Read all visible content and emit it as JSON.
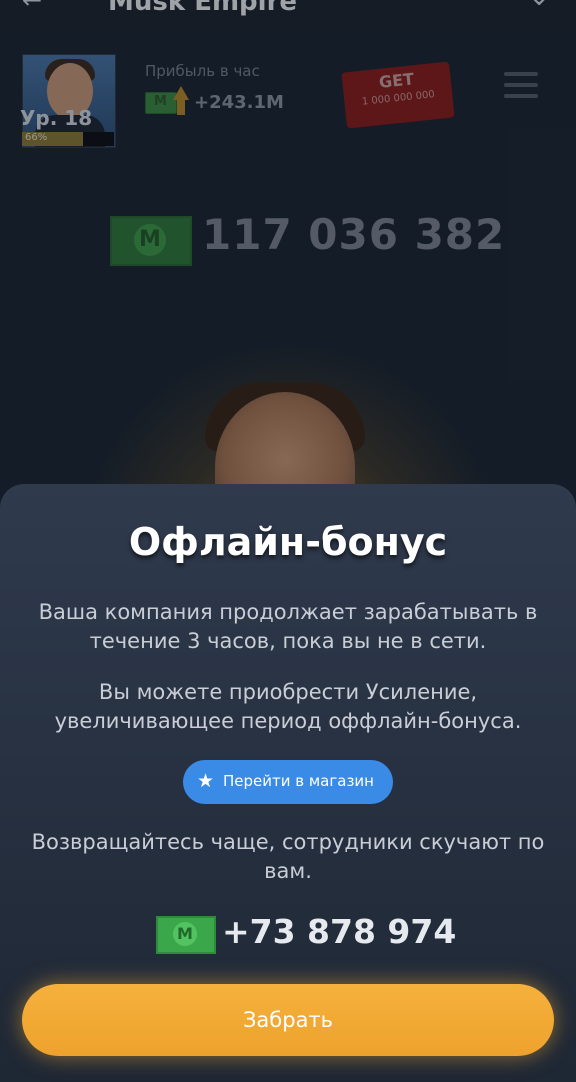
{
  "topbar": {
    "back": "←",
    "title": "Musk Empire",
    "chevron": "⌄"
  },
  "player": {
    "level_label": "Ур. 18",
    "progress_text": "66%",
    "progress": 0.66
  },
  "profit": {
    "label": "Прибыль в час",
    "value": "+243.1M"
  },
  "ticket": {
    "title": "GET",
    "amount": "1 000 000 000"
  },
  "balance": {
    "value": "117 036 382",
    "coin_letter": "M"
  },
  "sheet": {
    "title": "Офлайн-бонус",
    "paragraph1": "Ваша компания продолжает зарабатывать в течение 3 часов, пока вы не в сети.",
    "paragraph2": "Вы можете приобрести Усиление, увеличивающее период оффлайн-бонуса.",
    "shop_button": "Перейти в магазин",
    "paragraph3": "Возвращайтесь чаще, сотрудники скучают по вам.",
    "reward_value": "+73 878 974",
    "claim_button": "Забрать"
  },
  "colors": {
    "accent_blue": "#3a8be6",
    "claim_orange": "#f0a830",
    "money_green": "#3aa84a"
  }
}
